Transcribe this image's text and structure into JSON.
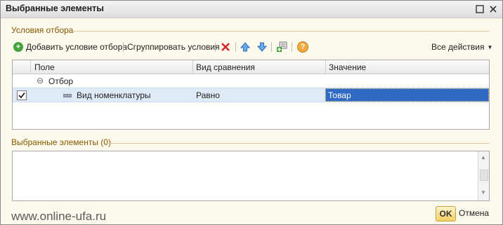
{
  "window": {
    "title": "Выбранные элементы"
  },
  "filter_section": {
    "label": "Условия отбора"
  },
  "toolbar": {
    "add_label": "Добавить условие отбора",
    "group_label": "Сгруппировать условия",
    "all_actions_label": "Все действия"
  },
  "table": {
    "columns": [
      "Поле",
      "Вид сравнения",
      "Значение"
    ],
    "group_row": {
      "label": "Отбор"
    },
    "row": {
      "field": "Вид номенклатуры",
      "comparison": "Равно",
      "value": "Товар",
      "checked": true
    }
  },
  "selected_section": {
    "label": "Выбранные элементы (0)"
  },
  "footer": {
    "watermark": "www.online-ufa.ru",
    "ok_label": "OK",
    "cancel_label": "Отмена"
  },
  "icons": {
    "add": "add-condition-icon",
    "delete": "delete-icon",
    "move_up": "arrow-up-icon",
    "move_down": "arrow-down-icon",
    "insert_group": "insert-group-icon",
    "help": "help-icon"
  },
  "colors": {
    "selection": "#316ac5",
    "row_highlight": "#dfeaf7",
    "section_label": "#8a5a00"
  }
}
